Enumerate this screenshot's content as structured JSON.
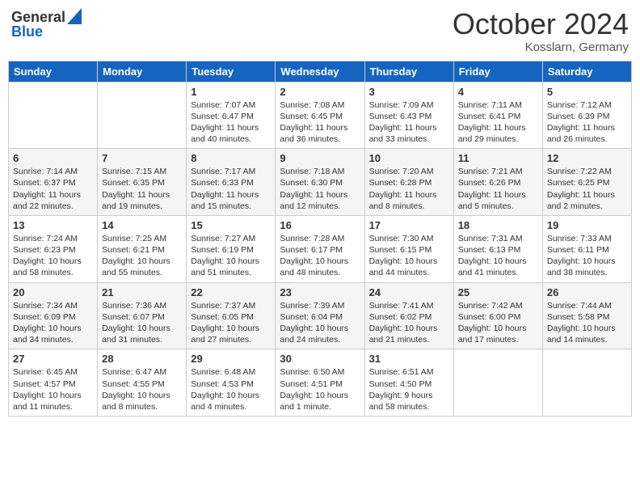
{
  "header": {
    "logo_general": "General",
    "logo_blue": "Blue",
    "month_title": "October 2024",
    "subtitle": "Kosslarn, Germany"
  },
  "days_of_week": [
    "Sunday",
    "Monday",
    "Tuesday",
    "Wednesday",
    "Thursday",
    "Friday",
    "Saturday"
  ],
  "weeks": [
    [
      {
        "day": "",
        "info": ""
      },
      {
        "day": "",
        "info": ""
      },
      {
        "day": "1",
        "info": "Sunrise: 7:07 AM\nSunset: 6:47 PM\nDaylight: 11 hours and 40 minutes."
      },
      {
        "day": "2",
        "info": "Sunrise: 7:08 AM\nSunset: 6:45 PM\nDaylight: 11 hours and 36 minutes."
      },
      {
        "day": "3",
        "info": "Sunrise: 7:09 AM\nSunset: 6:43 PM\nDaylight: 11 hours and 33 minutes."
      },
      {
        "day": "4",
        "info": "Sunrise: 7:11 AM\nSunset: 6:41 PM\nDaylight: 11 hours and 29 minutes."
      },
      {
        "day": "5",
        "info": "Sunrise: 7:12 AM\nSunset: 6:39 PM\nDaylight: 11 hours and 26 minutes."
      }
    ],
    [
      {
        "day": "6",
        "info": "Sunrise: 7:14 AM\nSunset: 6:37 PM\nDaylight: 11 hours and 22 minutes."
      },
      {
        "day": "7",
        "info": "Sunrise: 7:15 AM\nSunset: 6:35 PM\nDaylight: 11 hours and 19 minutes."
      },
      {
        "day": "8",
        "info": "Sunrise: 7:17 AM\nSunset: 6:33 PM\nDaylight: 11 hours and 15 minutes."
      },
      {
        "day": "9",
        "info": "Sunrise: 7:18 AM\nSunset: 6:30 PM\nDaylight: 11 hours and 12 minutes."
      },
      {
        "day": "10",
        "info": "Sunrise: 7:20 AM\nSunset: 6:28 PM\nDaylight: 11 hours and 8 minutes."
      },
      {
        "day": "11",
        "info": "Sunrise: 7:21 AM\nSunset: 6:26 PM\nDaylight: 11 hours and 5 minutes."
      },
      {
        "day": "12",
        "info": "Sunrise: 7:22 AM\nSunset: 6:25 PM\nDaylight: 11 hours and 2 minutes."
      }
    ],
    [
      {
        "day": "13",
        "info": "Sunrise: 7:24 AM\nSunset: 6:23 PM\nDaylight: 10 hours and 58 minutes."
      },
      {
        "day": "14",
        "info": "Sunrise: 7:25 AM\nSunset: 6:21 PM\nDaylight: 10 hours and 55 minutes."
      },
      {
        "day": "15",
        "info": "Sunrise: 7:27 AM\nSunset: 6:19 PM\nDaylight: 10 hours and 51 minutes."
      },
      {
        "day": "16",
        "info": "Sunrise: 7:28 AM\nSunset: 6:17 PM\nDaylight: 10 hours and 48 minutes."
      },
      {
        "day": "17",
        "info": "Sunrise: 7:30 AM\nSunset: 6:15 PM\nDaylight: 10 hours and 44 minutes."
      },
      {
        "day": "18",
        "info": "Sunrise: 7:31 AM\nSunset: 6:13 PM\nDaylight: 10 hours and 41 minutes."
      },
      {
        "day": "19",
        "info": "Sunrise: 7:33 AM\nSunset: 6:11 PM\nDaylight: 10 hours and 38 minutes."
      }
    ],
    [
      {
        "day": "20",
        "info": "Sunrise: 7:34 AM\nSunset: 6:09 PM\nDaylight: 10 hours and 34 minutes."
      },
      {
        "day": "21",
        "info": "Sunrise: 7:36 AM\nSunset: 6:07 PM\nDaylight: 10 hours and 31 minutes."
      },
      {
        "day": "22",
        "info": "Sunrise: 7:37 AM\nSunset: 6:05 PM\nDaylight: 10 hours and 27 minutes."
      },
      {
        "day": "23",
        "info": "Sunrise: 7:39 AM\nSunset: 6:04 PM\nDaylight: 10 hours and 24 minutes."
      },
      {
        "day": "24",
        "info": "Sunrise: 7:41 AM\nSunset: 6:02 PM\nDaylight: 10 hours and 21 minutes."
      },
      {
        "day": "25",
        "info": "Sunrise: 7:42 AM\nSunset: 6:00 PM\nDaylight: 10 hours and 17 minutes."
      },
      {
        "day": "26",
        "info": "Sunrise: 7:44 AM\nSunset: 5:58 PM\nDaylight: 10 hours and 14 minutes."
      }
    ],
    [
      {
        "day": "27",
        "info": "Sunrise: 6:45 AM\nSunset: 4:57 PM\nDaylight: 10 hours and 11 minutes."
      },
      {
        "day": "28",
        "info": "Sunrise: 6:47 AM\nSunset: 4:55 PM\nDaylight: 10 hours and 8 minutes."
      },
      {
        "day": "29",
        "info": "Sunrise: 6:48 AM\nSunset: 4:53 PM\nDaylight: 10 hours and 4 minutes."
      },
      {
        "day": "30",
        "info": "Sunrise: 6:50 AM\nSunset: 4:51 PM\nDaylight: 10 hours and 1 minute."
      },
      {
        "day": "31",
        "info": "Sunrise: 6:51 AM\nSunset: 4:50 PM\nDaylight: 9 hours and 58 minutes."
      },
      {
        "day": "",
        "info": ""
      },
      {
        "day": "",
        "info": ""
      }
    ]
  ]
}
